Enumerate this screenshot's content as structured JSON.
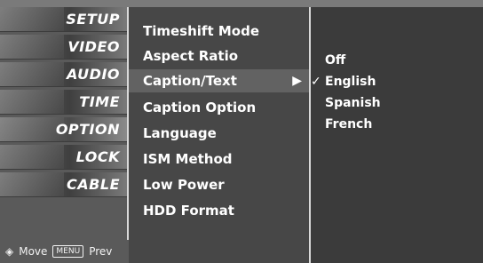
{
  "left_menu": {
    "items": [
      {
        "label": "SETUP"
      },
      {
        "label": "VIDEO"
      },
      {
        "label": "AUDIO"
      },
      {
        "label": "TIME"
      },
      {
        "label": "OPTION",
        "selected": true
      },
      {
        "label": "LOCK"
      },
      {
        "label": "CABLE"
      }
    ],
    "footer": {
      "move_label": "Move",
      "prev_button_label": "MENU",
      "prev_label": "Prev"
    }
  },
  "main_menu": {
    "items": [
      {
        "label": "Timeshift Mode"
      },
      {
        "label": "Aspect Ratio"
      },
      {
        "label": "Caption/Text",
        "selected": true,
        "has_submenu": true
      },
      {
        "label": "Caption Option"
      },
      {
        "label": "Language"
      },
      {
        "label": "ISM Method"
      },
      {
        "label": "Low Power"
      },
      {
        "label": "HDD Format"
      }
    ]
  },
  "submenu": {
    "options": [
      {
        "label": "Off",
        "selected": false
      },
      {
        "label": "English",
        "selected": true
      },
      {
        "label": "Spanish",
        "selected": false
      },
      {
        "label": "French",
        "selected": false
      }
    ]
  },
  "colors": {
    "background": "#3a3a3a",
    "menu_bg": "#474747",
    "highlight": "#626262",
    "text": "#ffffff",
    "divider": "#d9d9d9"
  }
}
